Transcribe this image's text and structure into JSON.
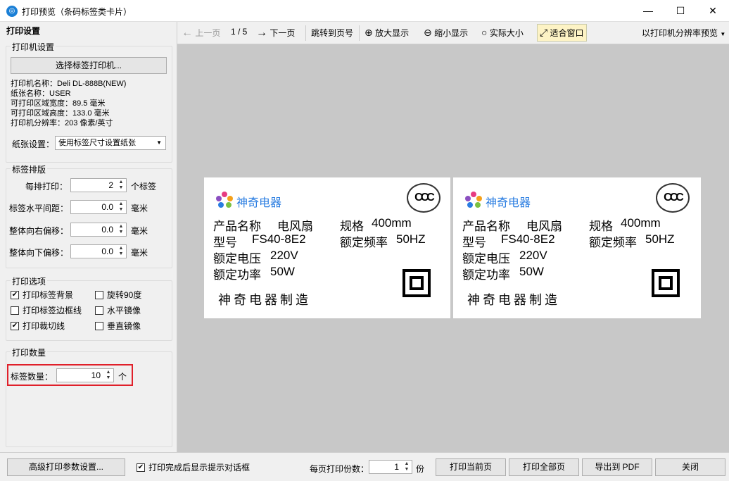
{
  "window": {
    "title": "打印预览（条码标签类卡片）",
    "app_icon": "printer-app-icon",
    "minimize": "—",
    "maximize": "☐",
    "close": "✕"
  },
  "left_panel": {
    "header": "打印设置",
    "printer_group": {
      "title": "打印机设置",
      "select_button": "选择标签打印机...",
      "printer_name": "打印机名称：Deli DL-888B(NEW)",
      "paper_name": "纸张名称：USER",
      "print_width": "可打印区域宽度：89.5 毫米",
      "print_height": "可打印区域高度：133.0 毫米",
      "resolution": "打印机分辨率：203 像素/英寸",
      "paper_label": "纸张设置：",
      "paper_value": "使用标签尺寸设置纸张"
    },
    "layout_group": {
      "title": "标签排版",
      "per_row_label": "每排打印：",
      "per_row_value": "2",
      "per_row_unit": "个标签",
      "h_gap_label": "标签水平间距：",
      "h_gap_value": "0.0",
      "h_gap_unit": "毫米",
      "right_offset_label": "整体向右偏移：",
      "right_offset_value": "0.0",
      "right_offset_unit": "毫米",
      "down_offset_label": "整体向下偏移：",
      "down_offset_value": "0.0",
      "down_offset_unit": "毫米"
    },
    "options_group": {
      "title": "打印选项",
      "print_bg": "打印标签背景",
      "print_border": "打印标签边框线",
      "print_cut": "打印裁切线",
      "rotate90": "旋转90度",
      "h_mirror": "水平镜像",
      "v_mirror": "垂直镜像",
      "print_bg_checked": true,
      "print_border_checked": false,
      "print_cut_checked": true,
      "rotate90_checked": false,
      "h_mirror_checked": false,
      "v_mirror_checked": false
    },
    "quantity_group": {
      "title": "打印数量",
      "label": "标签数量：",
      "value": "10",
      "unit": "个"
    }
  },
  "toolbar": {
    "prev": "上一页",
    "page_indicator": "1 / 5",
    "next": "下一页",
    "goto": "跳转到页号",
    "zoom_in": "放大显示",
    "zoom_out": "缩小显示",
    "actual_size": "实际大小",
    "fit_window": "适合窗口",
    "resolution_preview": "以打印机分辨率预览"
  },
  "label": {
    "brand": "神奇电器",
    "product_label": "产品名称",
    "product_value": "电风扇",
    "model_label": "型号",
    "model_value": "FS40-8E2",
    "voltage_label": "额定电压",
    "voltage_value": "220V",
    "power_label": "额定功率",
    "power_value": "50W",
    "spec_label": "规格",
    "spec_value": "400mm",
    "freq_label": "额定频率",
    "freq_value": "50HZ",
    "maker": "神奇电器制造",
    "ccc_mark": "CCC"
  },
  "bottom": {
    "advanced": "高级打印参数设置...",
    "show_dialog": "打印完成后显示提示对话框",
    "show_dialog_checked": true,
    "copies_label": "每页打印份数：",
    "copies_value": "1",
    "copies_unit": "份",
    "print_current": "打印当前页",
    "print_all": "打印全部页",
    "export_pdf": "导出到 PDF",
    "close": "关闭"
  }
}
